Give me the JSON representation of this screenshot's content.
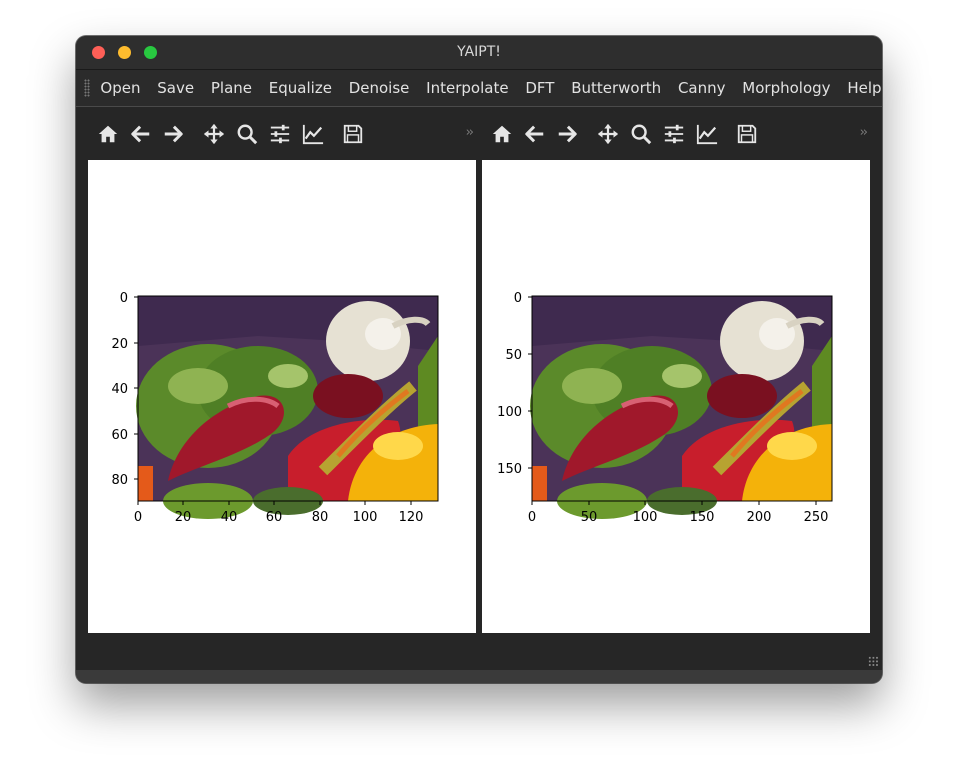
{
  "window": {
    "title": "YAIPT!"
  },
  "menu": {
    "items": [
      {
        "label": "Open"
      },
      {
        "label": "Save"
      },
      {
        "label": "Plane"
      },
      {
        "label": "Equalize"
      },
      {
        "label": "Denoise"
      },
      {
        "label": "Interpolate"
      },
      {
        "label": "DFT"
      },
      {
        "label": "Butterworth"
      },
      {
        "label": "Canny"
      },
      {
        "label": "Morphology"
      },
      {
        "label": "Help"
      }
    ]
  },
  "toolbar": {
    "icons": [
      "home-icon",
      "back-icon",
      "forward-icon",
      "pan-icon",
      "zoom-icon",
      "subplots-config-icon",
      "axes-edit-icon",
      "save-figure-icon"
    ],
    "overflow": "››"
  },
  "plots": {
    "left": {
      "image": "peppers (small)",
      "y_ticks": [
        "0",
        "20",
        "40",
        "60",
        "80"
      ],
      "x_ticks": [
        "0",
        "20",
        "40",
        "60",
        "80",
        "100",
        "120"
      ],
      "xlim": [
        0,
        132
      ],
      "ylim": [
        0,
        90
      ]
    },
    "right": {
      "image": "peppers (interpolated 2x)",
      "y_ticks": [
        "0",
        "50",
        "100",
        "150"
      ],
      "x_ticks": [
        "0",
        "50",
        "100",
        "150",
        "200",
        "250"
      ],
      "xlim": [
        0,
        264
      ],
      "ylim": [
        0,
        180
      ]
    }
  },
  "colors": {
    "window_bg": "#262626",
    "menu_text": "#e2e2e2",
    "toolbar_icon": "#e6e6e6",
    "plot_bg": "#ffffff"
  }
}
